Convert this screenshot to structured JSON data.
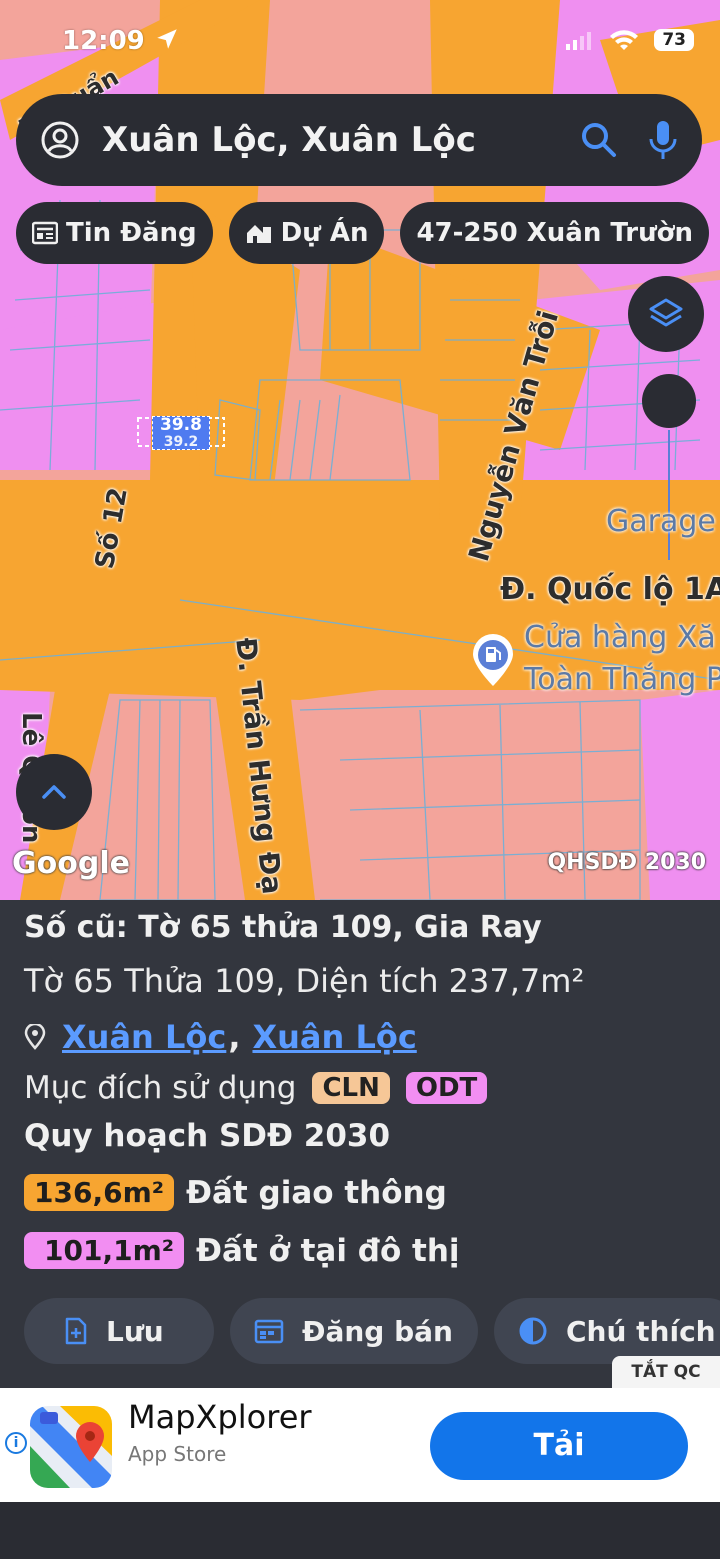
{
  "status": {
    "time": "12:09",
    "battery": "73"
  },
  "search": {
    "text": "Xuân Lộc, Xuân Lộc"
  },
  "chips": [
    {
      "label": "Tin Đăng",
      "icon": "news-icon"
    },
    {
      "label": "Dự Án",
      "icon": "building-icon"
    },
    {
      "label": "47-250 Xuân Trườn",
      "icon": ""
    }
  ],
  "map": {
    "streets": {
      "le_duan": "Lê Duẩn",
      "so_12": "Số 12",
      "nguyen_van_troi": "Nguyễn Văn Trỗi",
      "quoc_lo": "Đ. Quốc lộ 1A",
      "tran_hung_dao": "Đ. Trần Hưng Đạ",
      "left_edge": "Lê Q...ồn"
    },
    "pois": {
      "garage": "Garage",
      "fuel_line1": "Cửa hàng Xă",
      "fuel_line2": "Toàn Thắng P"
    },
    "lot_label_top": "39.8",
    "lot_label_bottom": "39.2",
    "google": "Google",
    "layer_name": "QHSDĐ 2030",
    "colors": {
      "transport": "#f7a531",
      "urban_residential": "#ef8ff0",
      "perennial": "#f3a49b"
    }
  },
  "panel": {
    "title": "Số cũ: Tờ 65 thửa 109, Gia Ray",
    "line": "Tờ 65 Thửa 109, Diện tích 237,7m²",
    "location": [
      "Xuân Lộc",
      "Xuân Lộc"
    ],
    "comma": ",",
    "usage_label": "Mục đích sử dụng",
    "usage_tags": [
      {
        "code": "CLN",
        "color": "#f6c797"
      },
      {
        "code": "ODT",
        "color": "#f28ef2"
      }
    ],
    "plan_title": "Quy hoạch SDĐ 2030",
    "plan_rows": [
      {
        "area": "136,6m²",
        "label": "Đất giao thông",
        "color": "#f7a531"
      },
      {
        "area": "101,1m²",
        "label": "Đất ở tại đô thị",
        "color": "#f28ef2"
      }
    ],
    "actions": [
      {
        "label": "Lưu",
        "icon": "save-icon"
      },
      {
        "label": "Đăng bán",
        "icon": "calendar-icon"
      },
      {
        "label": "Chú thích",
        "icon": "legend-icon"
      }
    ],
    "ads_off": "TẮT QC"
  },
  "ad": {
    "app_name": "MapXplorer",
    "store": "App Store",
    "button": "Tải",
    "info_icon": "i"
  }
}
